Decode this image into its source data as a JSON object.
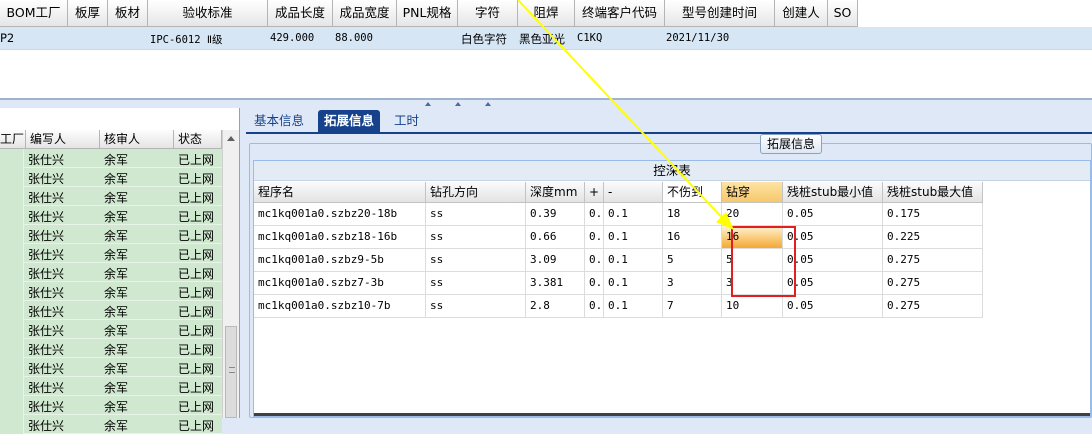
{
  "top_grid": {
    "headers": [
      "BOM工厂",
      "板厚",
      "板材",
      "验收标准",
      "成品长度",
      "成品宽度",
      "PNL规格",
      "字符",
      "阻焊",
      "终端客户代码",
      "型号创建时间",
      "创建人",
      "SO"
    ],
    "row": {
      "bom_factory": "P2",
      "acceptance": "IPC-6012 Ⅱ级",
      "length": "429.000",
      "width": "88.000",
      "character": "白色字符",
      "solder_mask": "黑色亚光",
      "customer_code": "C1KQ",
      "created": "2021/11/30"
    }
  },
  "left_grid": {
    "headers": [
      "工厂",
      "编写人",
      "核审人",
      "状态"
    ],
    "rows": [
      {
        "writer": "张仕兴",
        "reviewer": "余军",
        "status": "已上网"
      },
      {
        "writer": "张仕兴",
        "reviewer": "余军",
        "status": "已上网"
      },
      {
        "writer": "张仕兴",
        "reviewer": "余军",
        "status": "已上网"
      },
      {
        "writer": "张仕兴",
        "reviewer": "余军",
        "status": "已上网"
      },
      {
        "writer": "张仕兴",
        "reviewer": "余军",
        "status": "已上网"
      },
      {
        "writer": "张仕兴",
        "reviewer": "余军",
        "status": "已上网"
      },
      {
        "writer": "张仕兴",
        "reviewer": "余军",
        "status": "已上网"
      },
      {
        "writer": "张仕兴",
        "reviewer": "余军",
        "status": "已上网"
      },
      {
        "writer": "张仕兴",
        "reviewer": "余军",
        "status": "已上网"
      },
      {
        "writer": "张仕兴",
        "reviewer": "余军",
        "status": "已上网"
      },
      {
        "writer": "张仕兴",
        "reviewer": "余军",
        "status": "已上网"
      },
      {
        "writer": "张仕兴",
        "reviewer": "余军",
        "status": "已上网"
      },
      {
        "writer": "张仕兴",
        "reviewer": "余军",
        "status": "已上网"
      },
      {
        "writer": "张仕兴",
        "reviewer": "余军",
        "status": "已上网"
      },
      {
        "writer": "张仕兴",
        "reviewer": "余军",
        "status": "已上网"
      }
    ]
  },
  "tabs": [
    "基本信息",
    "拓展信息",
    "工时"
  ],
  "active_tab": "拓展信息",
  "fieldset_legend": "拓展信息",
  "depth_table": {
    "title": "控深表",
    "headers": [
      "程序名",
      "钻孔方向",
      "深度mm",
      "+",
      "-",
      "不伤到",
      "钻穿",
      "残桩stub最小值",
      "残桩stub最大值"
    ],
    "rows": [
      {
        "program": "mc1kq001a0.szbz20-18b",
        "direction": "ss",
        "depth": "0.39",
        "plus": "0..",
        "minus": "0.1",
        "no_damage": "18",
        "through": "20",
        "stub_min": "0.05",
        "stub_max": "0.175"
      },
      {
        "program": "mc1kq001a0.szbz18-16b",
        "direction": "ss",
        "depth": "0.66",
        "plus": "0..",
        "minus": "0.1",
        "no_damage": "16",
        "through": "16",
        "stub_min": "0.05",
        "stub_max": "0.225"
      },
      {
        "program": "mc1kq001a0.szbz9-5b",
        "direction": "ss",
        "depth": "3.09",
        "plus": "0..",
        "minus": "0.1",
        "no_damage": "5",
        "through": "5",
        "stub_min": "0.05",
        "stub_max": "0.275"
      },
      {
        "program": "mc1kq001a0.szbz7-3b",
        "direction": "ss",
        "depth": "3.381",
        "plus": "0..",
        "minus": "0.1",
        "no_damage": "3",
        "through": "3",
        "stub_min": "0.05",
        "stub_max": "0.275"
      },
      {
        "program": "mc1kq001a0.szbz10-7b",
        "direction": "ss",
        "depth": "2.8",
        "plus": "0..",
        "minus": "0.1",
        "no_damage": "7",
        "through": "10",
        "stub_min": "0.05",
        "stub_max": "0.275"
      }
    ]
  },
  "colors": {
    "tab_active": "#15428b",
    "left_row_bg": "#cfe8cf",
    "highlight_orange": "#f5a832",
    "annotation_red": "#e02020",
    "annotation_arrow": "#ffff00"
  }
}
